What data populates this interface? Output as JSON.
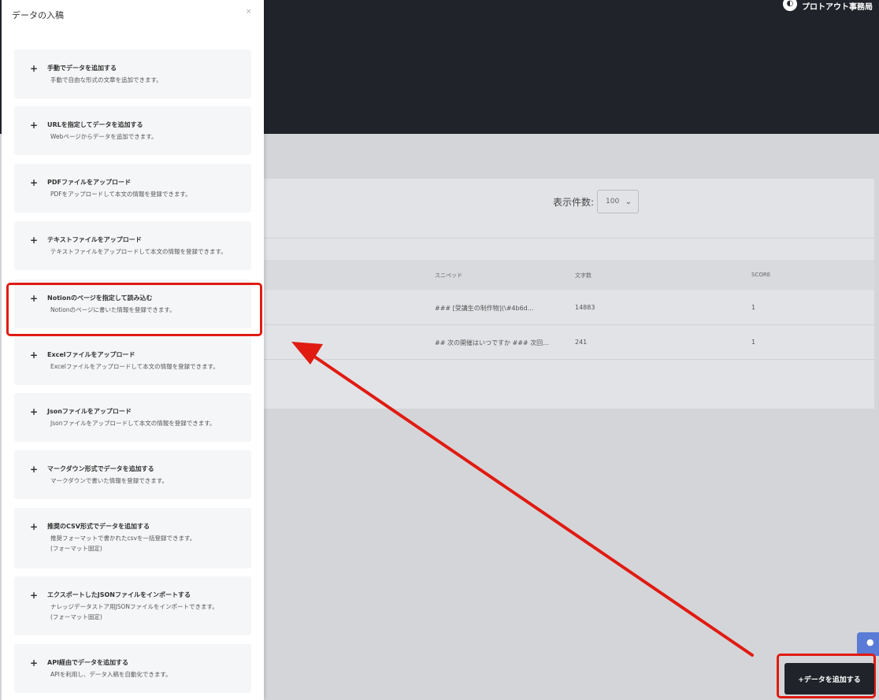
{
  "app": {
    "brand_name": "プロトアウト事務局",
    "brand_logo_icon": "brand-logo-icon"
  },
  "table": {
    "per_page_label": "表示件数:",
    "per_page_value": "100",
    "columns": [
      "スニペッド",
      "文字数",
      "SCORE"
    ],
    "rows": [
      {
        "snippet": "### [受講生の制作物](\\#4b6d...",
        "chars": "14883",
        "score": "1"
      },
      {
        "snippet": "## 次の開催はいつですか ### 次回...",
        "chars": "241",
        "score": "1"
      }
    ]
  },
  "add_button_label": "+データを追加する",
  "chat_icon": "chat-bubble-icon",
  "drawer": {
    "title": "データの入稿",
    "close": "×",
    "items": [
      {
        "title": "手動でデータを追加する",
        "desc": [
          "手動で自由な形式の文章を追加できます。"
        ]
      },
      {
        "title": "URLを指定してデータを追加する",
        "desc": [
          "Webページからデータを追加できます。"
        ]
      },
      {
        "title": "PDFファイルをアップロード",
        "desc": [
          "PDFをアップロードして本文の情報を登録できます。"
        ]
      },
      {
        "title": "テキストファイルをアップロード",
        "desc": [
          "テキストファイルをアップロードして本文の情報を登録できます。"
        ]
      },
      {
        "title": "Notionのページを指定して読み込む",
        "desc": [
          "Notionのページに書いた情報を登録できます。"
        ]
      },
      {
        "title": "Excelファイルをアップロード",
        "desc": [
          "Excelファイルをアップロードして本文の情報を登録できます。"
        ]
      },
      {
        "title": "Jsonファイルをアップロード",
        "desc": [
          "Jsonファイルをアップロードして本文の情報を登録できます。"
        ]
      },
      {
        "title": "マークダウン形式でデータを追加する",
        "desc": [
          "マークダウンで書いた情報を登録できます。"
        ]
      },
      {
        "title": "推奨のCSV形式でデータを追加する",
        "desc": [
          "推奨フォーマットで書かれたcsvを一括登録できます。",
          "(フォーマット固定)"
        ]
      },
      {
        "title": "エクスポートしたJSONファイルをインポートする",
        "desc": [
          "ナレッジデータストア用JSONファイルをインポートできます。",
          "(フォーマット固定)"
        ]
      },
      {
        "title": "API経由でデータを追加する",
        "desc": [
          "APIを利用し、データ入稿を自動化できます。"
        ]
      }
    ]
  },
  "annotation": {
    "color": "#e01b12"
  }
}
